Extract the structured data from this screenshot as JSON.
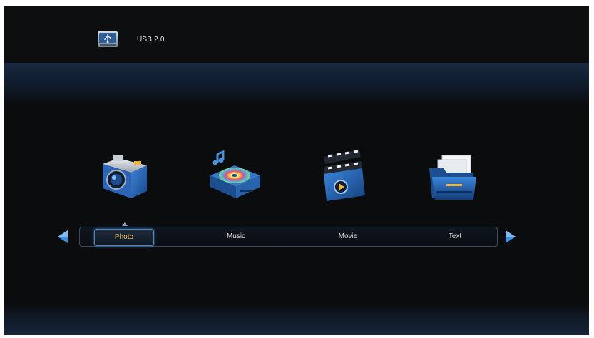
{
  "device": {
    "label": "USB 2.0",
    "icon": "usb-drive-icon"
  },
  "media_icons": [
    {
      "name": "camera-icon"
    },
    {
      "name": "music-disc-icon"
    },
    {
      "name": "clapperboard-icon"
    },
    {
      "name": "folder-documents-icon"
    }
  ],
  "menu": {
    "selected_index": 0,
    "items": [
      {
        "label": "Photo"
      },
      {
        "label": "Music"
      },
      {
        "label": "Movie"
      },
      {
        "label": "Text"
      }
    ],
    "prev_icon": "left-arrow-icon",
    "next_icon": "right-arrow-icon"
  },
  "colors": {
    "background": "#0b0c0e",
    "accent": "#4d86c2",
    "selected_text": "#f0c060",
    "arrow": "#3f8fe0"
  }
}
